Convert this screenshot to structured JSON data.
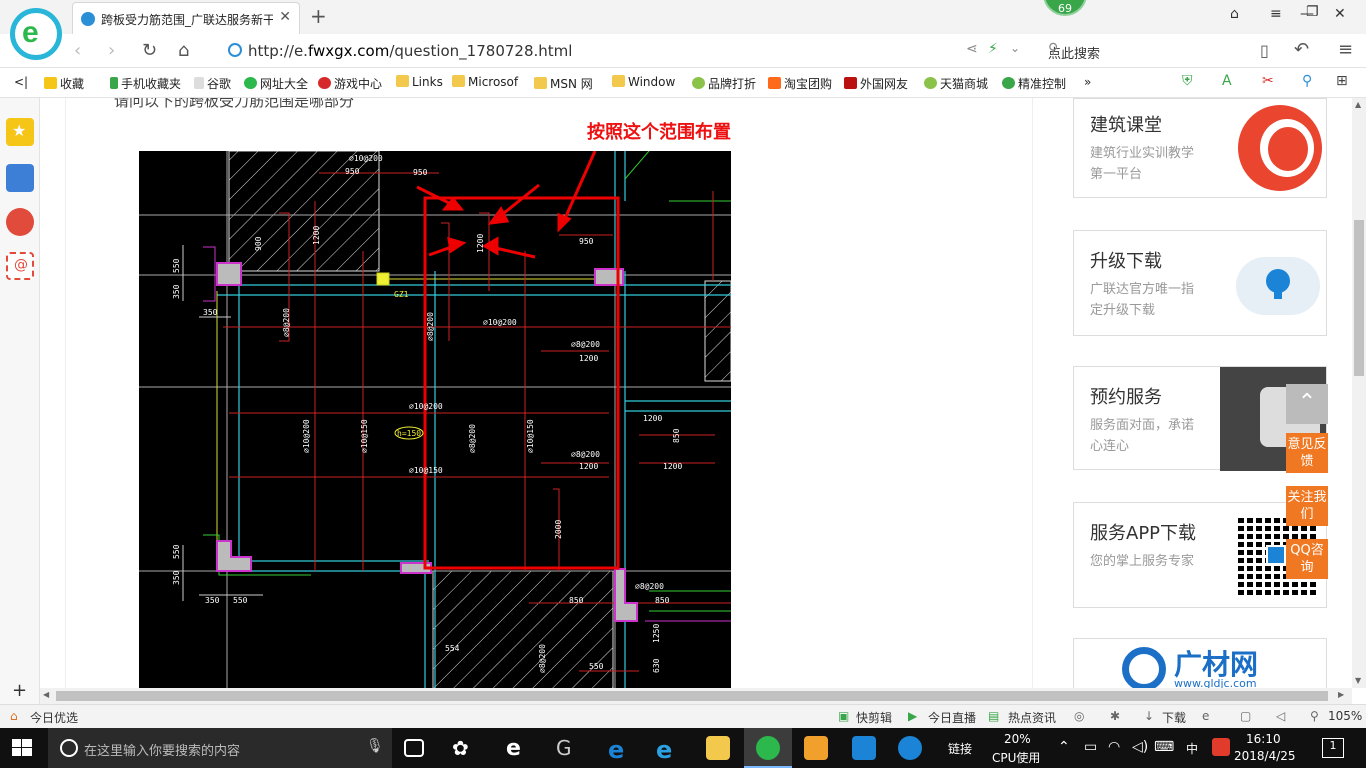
{
  "browser": {
    "tab_title": "跨板受力筋范围_广联达服务新干线",
    "badge_count": "69",
    "url_prefix": "http://e.",
    "url_domain": "fwxgx.com",
    "url_path": "/question_1780728.html",
    "search_placeholder": "点此搜索"
  },
  "bookmarks": [
    "收藏",
    "手机收藏夹",
    "谷歌",
    "网址大全",
    "游戏中心",
    "Links",
    "Microsof",
    "MSN 网",
    "Window",
    "品牌打折",
    "淘宝团购",
    "外国网友",
    "天猫商城",
    "精准控制"
  ],
  "page": {
    "question_text": "请问以下的跨板受力筋范围是哪部分",
    "annotation": "按照这个范围布置"
  },
  "cad_labels": {
    "l950a": "950",
    "l950b": "950",
    "l950c": "950",
    "l1200a": "1200",
    "l1200b": "1200",
    "l1200c": "1200",
    "l1200d": "1200",
    "l1200e": "1200",
    "l900a": "900",
    "l900b": "900",
    "gz1": "GZ1",
    "l350a": "350",
    "l550a": "550",
    "l550b": "550",
    "l350b": "350",
    "r1": "⌀10@200",
    "r2": "⌀8@200",
    "r3": "⌀10@200",
    "r4": "⌀10@200",
    "r5": "⌀8@200",
    "r6": "⌀10@150",
    "r7": "⌀10@200",
    "r8": "⌀8@200",
    "r9": "⌀8@200",
    "r10": "⌀10@150",
    "h150": "h=150",
    "l2000": "2000",
    "l850a": "850",
    "l850b": "850",
    "l850c": "850",
    "l554": "554",
    "l630": "630",
    "l1250": "1250",
    "l1200f": "1200",
    "l1200g": "1200"
  },
  "sidebar_cards": [
    {
      "title": "建筑课堂",
      "desc": "建筑行业实训教学第一平台"
    },
    {
      "title": "升级下载",
      "desc": "广联达官方唯一指定升级下载"
    },
    {
      "title": "预约服务",
      "desc": "服务面对面，承诺心连心"
    },
    {
      "title": "服务APP下载",
      "desc": "您的掌上服务专家"
    },
    {
      "title": "广材网",
      "desc": "www.gldjc.com"
    }
  ],
  "float_buttons": [
    "意见反馈",
    "关注我们",
    "QQ咨询"
  ],
  "statusbar": {
    "left": "今日优选",
    "items": [
      "快剪辑",
      "今日直播",
      "热点资讯",
      "下载"
    ],
    "zoom": "105%"
  },
  "taskbar": {
    "search_placeholder": "在这里输入你要搜索的内容",
    "link_label": "链接",
    "cpu_percent": "20%",
    "cpu_label": "CPU使用",
    "ime": "中",
    "time": "16:10",
    "date": "2018/4/25",
    "notifications": "1"
  },
  "colors": {
    "accent": "#f07822",
    "cad_bg": "#000000",
    "annotation": "#e11111",
    "browser_green": "#2db84d"
  }
}
